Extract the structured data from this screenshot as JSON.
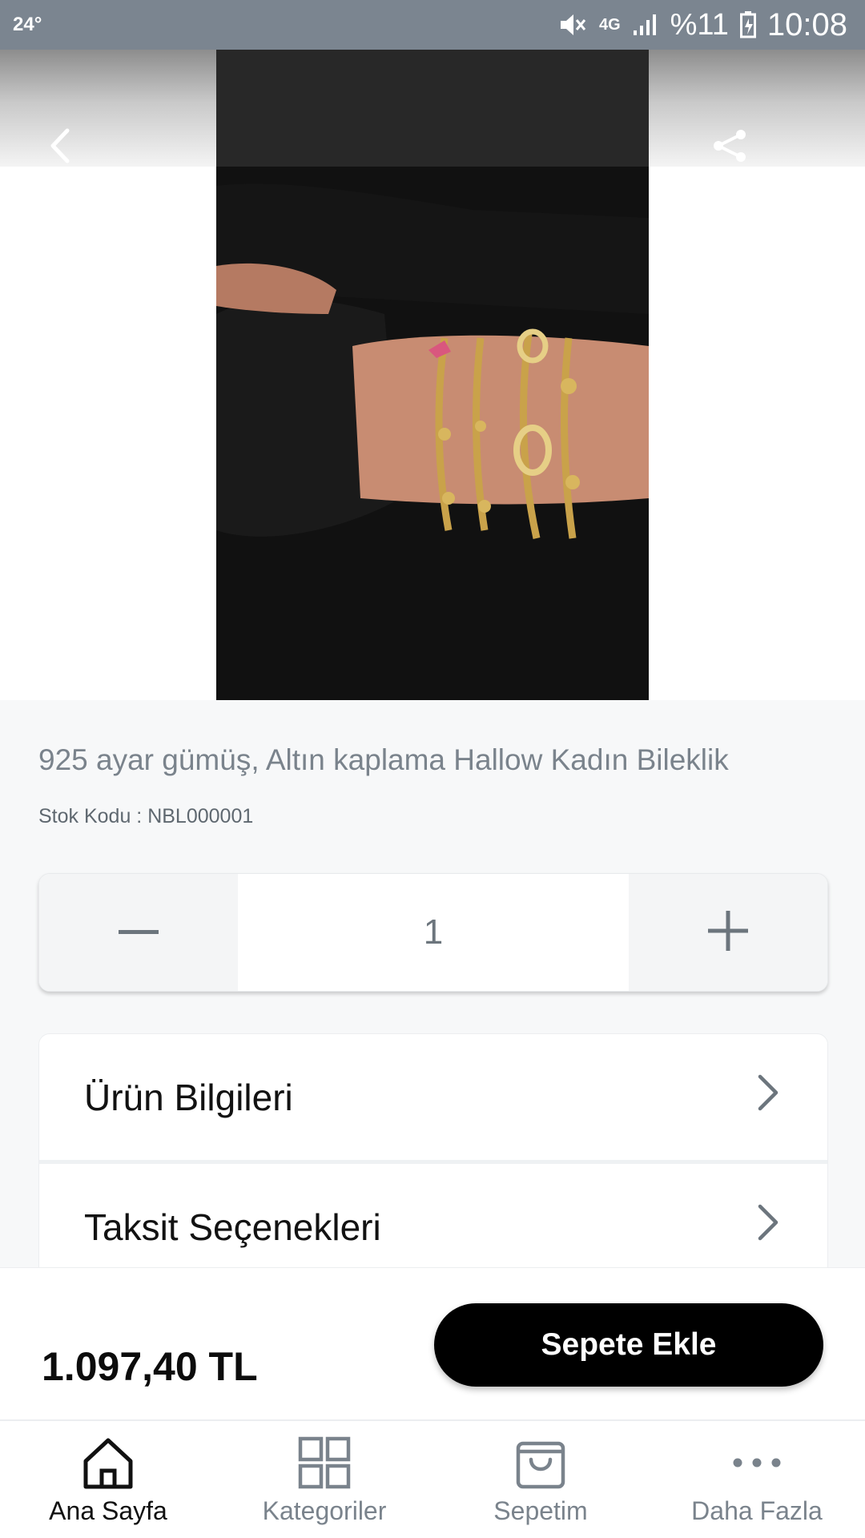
{
  "status_bar": {
    "temperature": "24°",
    "network": "4G",
    "battery": "%11",
    "time": "10:08"
  },
  "header": {
    "back_icon": "chevron-left-icon",
    "share_icon": "share-icon"
  },
  "product": {
    "title": "925 ayar gümüş, Altın kaplama Hallow Kadın Bileklik",
    "sku": "Stok Kodu : NBL000001",
    "quantity": "1",
    "price": "1.097,40 TL"
  },
  "info_sections": [
    {
      "label": "Ürün Bilgileri",
      "icon": "chevron-right-icon"
    },
    {
      "label": "Taksit Seçenekleri",
      "icon": "chevron-right-icon"
    }
  ],
  "actions": {
    "add_to_cart": "Sepete Ekle"
  },
  "bottom_nav": [
    {
      "label": "Ana Sayfa",
      "icon": "home-icon",
      "active": true
    },
    {
      "label": "Kategoriler",
      "icon": "grid-icon",
      "active": false
    },
    {
      "label": "Sepetim",
      "icon": "shopping-bag-icon",
      "active": false
    },
    {
      "label": "Daha Fazla",
      "icon": "more-icon",
      "active": false
    }
  ],
  "colors": {
    "status_bar": "#7b8590",
    "primary_button": "#000000",
    "muted_text": "#7a838c",
    "background": "#f7f8f9"
  }
}
